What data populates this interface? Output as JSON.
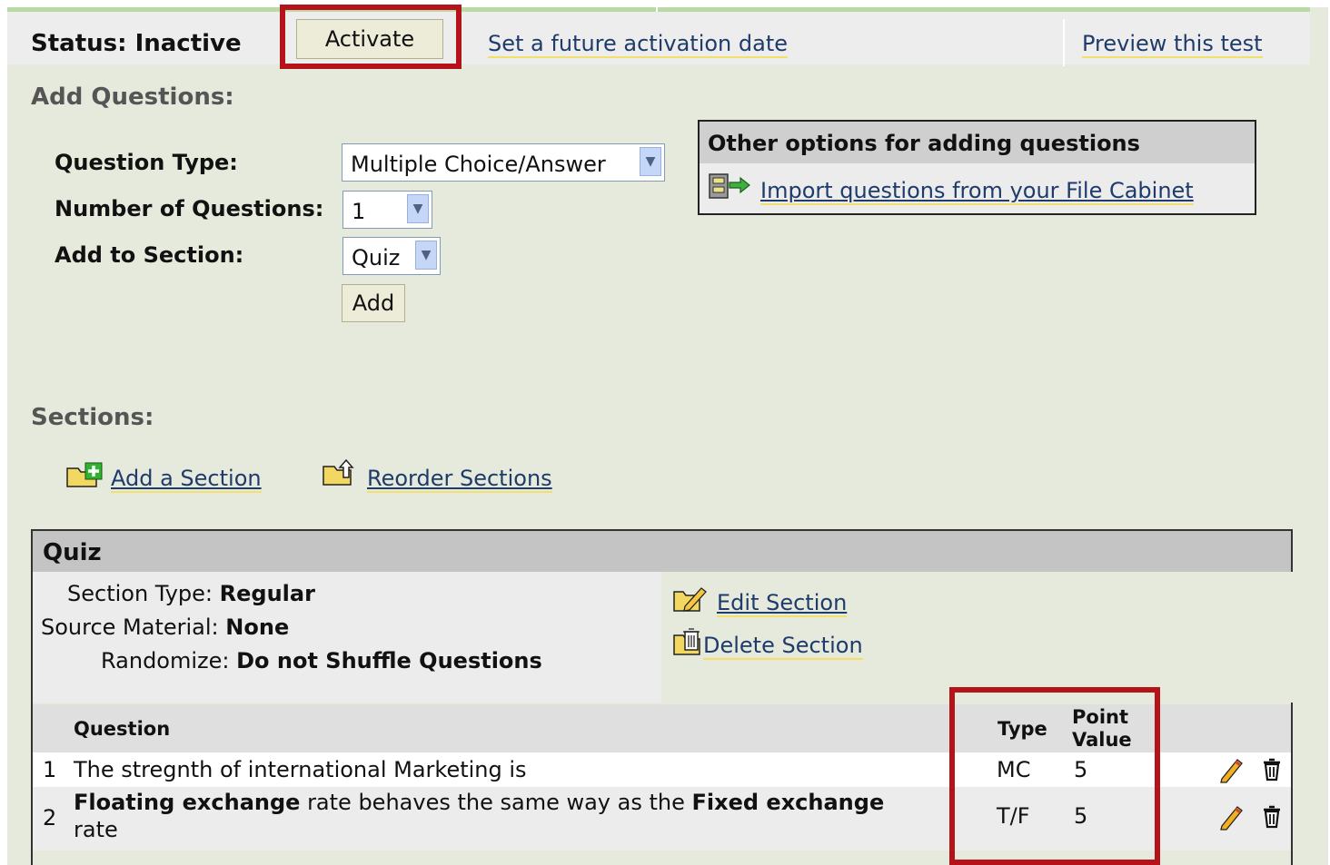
{
  "status": {
    "label": "Status: Inactive",
    "activate_button": "Activate",
    "future_link": "Set a future activation date",
    "preview_link": "Preview this test"
  },
  "add_questions": {
    "heading": "Add Questions:",
    "question_type_label": "Question Type:",
    "question_type_value": "Multiple Choice/Answer",
    "number_label": "Number of Questions:",
    "number_value": "1",
    "section_label": "Add to Section:",
    "section_value": "Quiz",
    "add_button": "Add"
  },
  "other_options": {
    "header": "Other options for adding questions",
    "import_link": "Import questions from your File Cabinet"
  },
  "sections": {
    "heading": "Sections:",
    "add_section": "Add a Section",
    "reorder_sections": "Reorder Sections"
  },
  "quiz": {
    "title": "Quiz",
    "section_type_label": "Section Type:",
    "section_type_value": "Regular",
    "source_label": "Source Material:",
    "source_value": "None",
    "randomize_label": "Randomize:",
    "randomize_value": "Do not Shuffle Questions",
    "edit_section": "Edit Section",
    "delete_section": "Delete Section",
    "columns": {
      "question": "Question",
      "type": "Type",
      "point_line1": "Point",
      "point_line2": "Value"
    },
    "rows": [
      {
        "num": "1",
        "text": "The stregnth of international Marketing is",
        "type": "MC",
        "points": "5"
      },
      {
        "num": "2",
        "bold1": "Floating exchange",
        "mid": " rate behaves the same way as the ",
        "bold2": "Fixed exchange",
        "line2": "rate",
        "type": "T/F",
        "points": "5"
      }
    ]
  },
  "colors": {
    "highlight": "#b4131a",
    "link": "#1e3b6b",
    "link_underline": "#f3df6b",
    "panel_bg": "#e6eadc"
  }
}
